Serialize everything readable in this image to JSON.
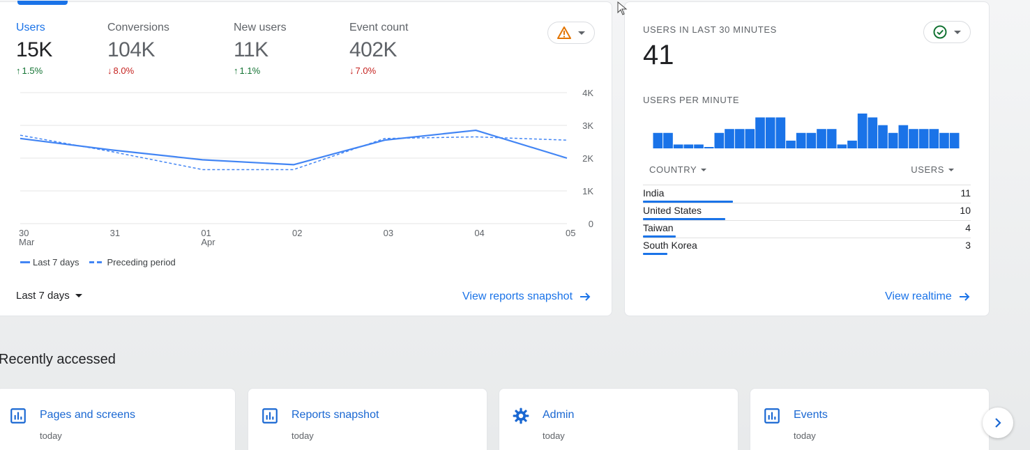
{
  "overview": {
    "metrics": [
      {
        "label": "Users",
        "value": "15K",
        "change": "1.5%",
        "direction": "up",
        "active": true
      },
      {
        "label": "Conversions",
        "value": "104K",
        "change": "8.0%",
        "direction": "down",
        "active": false
      },
      {
        "label": "New users",
        "value": "11K",
        "change": "1.1%",
        "direction": "up",
        "active": false
      },
      {
        "label": "Event count",
        "value": "402K",
        "change": "7.0%",
        "direction": "down",
        "active": false
      }
    ],
    "alert_icon": "warning-icon",
    "legend": {
      "current": "Last 7 days",
      "previous": "Preceding period"
    },
    "date_range": "Last 7 days",
    "view_link": "View reports snapshot"
  },
  "chart_data": {
    "type": "line",
    "x": [
      "30 Mar",
      "31",
      "01 Apr",
      "02",
      "03",
      "04",
      "05"
    ],
    "x_tick_labels": [
      [
        "30",
        "Mar"
      ],
      [
        "31"
      ],
      [
        "01",
        "Apr"
      ],
      [
        "02"
      ],
      [
        "03"
      ],
      [
        "04"
      ],
      [
        "05"
      ]
    ],
    "y_ticks": [
      "0",
      "1K",
      "2K",
      "3K",
      "4K"
    ],
    "ylim": [
      0,
      4000
    ],
    "series": [
      {
        "name": "Last 7 days",
        "style": "solid",
        "color": "#4285f4",
        "values": [
          2600,
          2250,
          1950,
          1800,
          2550,
          2850,
          2000
        ]
      },
      {
        "name": "Preceding period",
        "style": "dashed",
        "color": "#4285f4",
        "values": [
          2700,
          2200,
          1650,
          1650,
          2600,
          2650,
          2550
        ]
      }
    ],
    "legend_position": "bottom-left",
    "grid": true
  },
  "realtime": {
    "heading": "USERS IN LAST 30 MINUTES",
    "value": "41",
    "status_icon": "check-circle-icon",
    "per_minute_heading": "USERS PER MINUTE",
    "per_minute_values": [
      4,
      4,
      1,
      1,
      1,
      0,
      4,
      5,
      5,
      5,
      8,
      8,
      8,
      2,
      4,
      4,
      5,
      5,
      1,
      2,
      9,
      8,
      6,
      4,
      6,
      5,
      5,
      5,
      4,
      4
    ],
    "bar_color": "#1a73e8",
    "table": {
      "col_country": "COUNTRY",
      "col_users": "USERS",
      "rows": [
        {
          "country": "India",
          "users": "11",
          "share": 0.275
        },
        {
          "country": "United States",
          "users": "10",
          "share": 0.25
        },
        {
          "country": "Taiwan",
          "users": "4",
          "share": 0.1
        },
        {
          "country": "South Korea",
          "users": "3",
          "share": 0.075
        }
      ]
    },
    "view_link": "View realtime"
  },
  "recent": {
    "title": "Recently accessed",
    "cards": [
      {
        "title": "Pages and screens",
        "sub": "today",
        "icon": "bar-chart-icon"
      },
      {
        "title": "Reports snapshot",
        "sub": "today",
        "icon": "bar-chart-icon"
      },
      {
        "title": "Admin",
        "sub": "today",
        "icon": "gear-icon"
      },
      {
        "title": "Events",
        "sub": "today",
        "icon": "bar-chart-icon"
      }
    ],
    "next_icon": "chevron-right-icon"
  }
}
